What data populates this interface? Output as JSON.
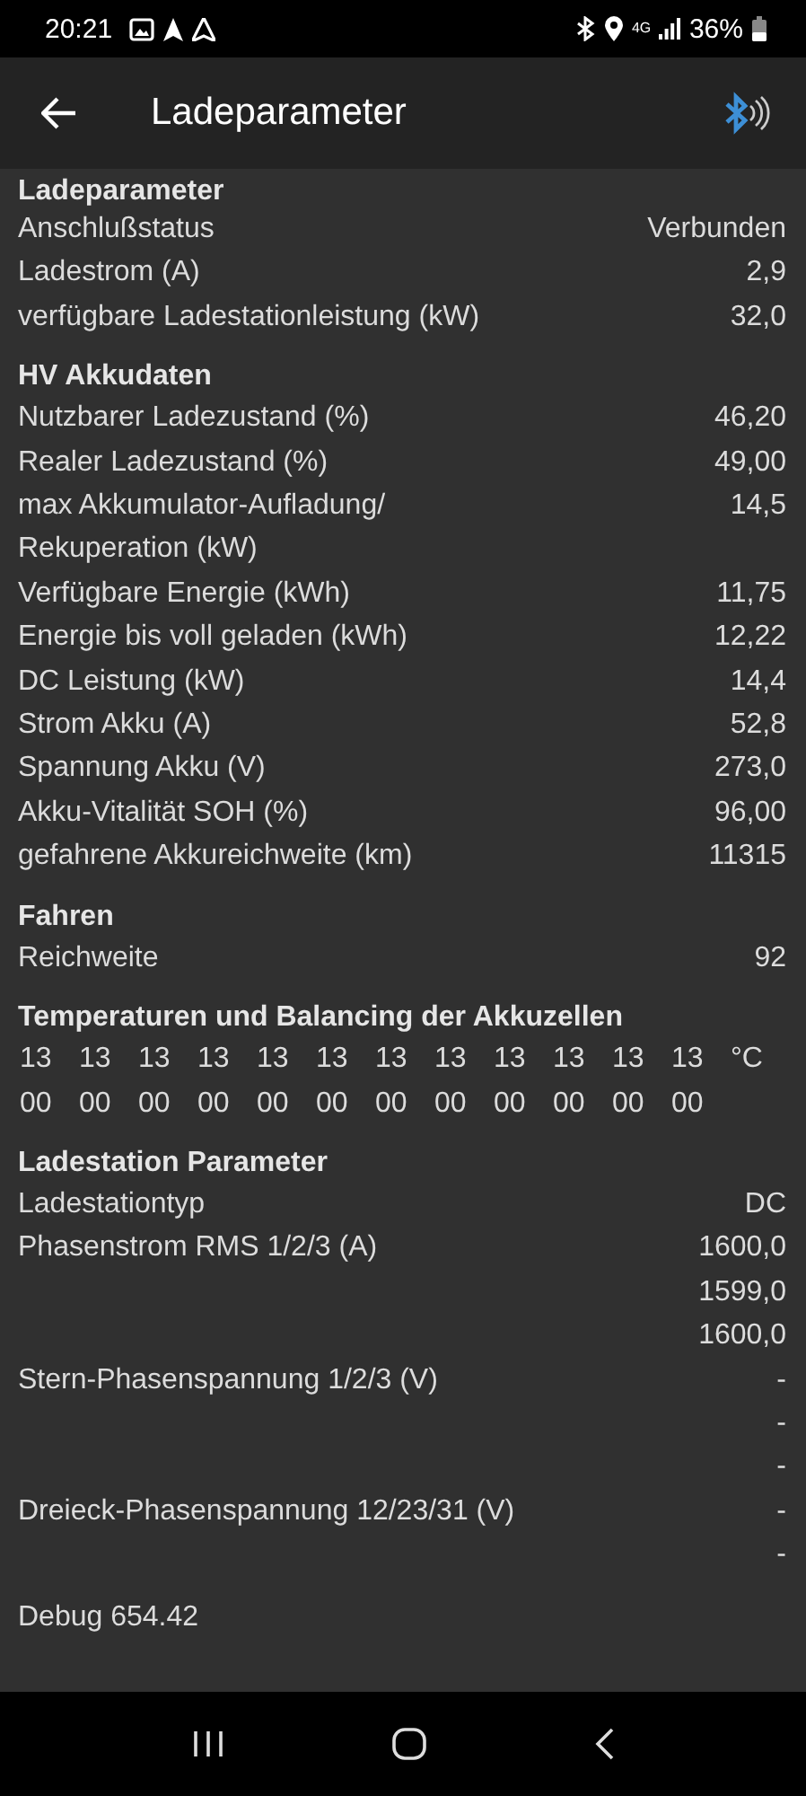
{
  "status_bar": {
    "time": "20:21",
    "network": "4G",
    "battery": "36%"
  },
  "app_bar": {
    "title": "Ladeparameter"
  },
  "sections": [
    {
      "title": "Ladeparameter",
      "rows": [
        {
          "kind": "pair",
          "label": "Anschlußstatus",
          "values": [
            "Verbunden"
          ]
        },
        {
          "kind": "pair",
          "label": "Ladestrom (A)",
          "values": [
            "2,9"
          ]
        },
        {
          "kind": "pair",
          "label": "verfügbare Ladestationleistung (kW)",
          "values": [
            "32,0"
          ]
        }
      ]
    },
    {
      "title": "HV Akkudaten",
      "rows": [
        {
          "kind": "pair",
          "label": "Nutzbarer Ladezustand (%)",
          "values": [
            "46,20"
          ]
        },
        {
          "kind": "pair",
          "label": "Realer Ladezustand (%)",
          "values": [
            "49,00"
          ]
        },
        {
          "kind": "pair",
          "label": "max Akkumulator-Aufladung/ Rekuperation (kW)",
          "values": [
            "14,5"
          ]
        },
        {
          "kind": "pair",
          "label": "Verfügbare Energie (kWh)",
          "values": [
            "11,75"
          ]
        },
        {
          "kind": "pair",
          "label": "Energie bis voll geladen (kWh)",
          "values": [
            "12,22"
          ]
        },
        {
          "kind": "pair",
          "label": "DC Leistung (kW)",
          "values": [
            "14,4"
          ]
        },
        {
          "kind": "pair",
          "label": "Strom Akku (A)",
          "values": [
            "52,8"
          ]
        },
        {
          "kind": "pair",
          "label": "Spannung Akku (V)",
          "values": [
            "273,0"
          ]
        },
        {
          "kind": "pair",
          "label": "Akku-Vitalität SOH (%)",
          "values": [
            "96,00"
          ]
        },
        {
          "kind": "pair",
          "label": "gefahrene Akkureichweite (km)",
          "values": [
            "11315"
          ]
        }
      ]
    },
    {
      "title": "Fahren",
      "rows": [
        {
          "kind": "pair",
          "label": "Reichweite",
          "values": [
            "92"
          ]
        }
      ]
    },
    {
      "title": "Temperaturen und Balancing der Akkuzellen",
      "rows": [
        {
          "kind": "cells",
          "values": [
            "13",
            "13",
            "13",
            "13",
            "13",
            "13",
            "13",
            "13",
            "13",
            "13",
            "13",
            "13"
          ],
          "unit": "°C"
        },
        {
          "kind": "cells",
          "values": [
            "00",
            "00",
            "00",
            "00",
            "00",
            "00",
            "00",
            "00",
            "00",
            "00",
            "00",
            "00"
          ]
        }
      ]
    },
    {
      "title": "Ladestation Parameter",
      "rows": [
        {
          "kind": "pair",
          "label": "Ladestationtyp",
          "values": [
            "DC"
          ]
        },
        {
          "kind": "pair",
          "label": "Phasenstrom RMS 1/2/3 (A)",
          "values": [
            "1600,0",
            "1599,0",
            "1600,0"
          ]
        },
        {
          "kind": "pair",
          "label": "Stern-Phasenspannung 1/2/3 (V)",
          "values": [
            "-",
            "-",
            "-"
          ]
        },
        {
          "kind": "pair",
          "label": "Dreieck-Phasenspannung 12/23/31 (V)",
          "values": [
            "-",
            "-"
          ]
        }
      ]
    }
  ],
  "debug": "Debug 654.42"
}
